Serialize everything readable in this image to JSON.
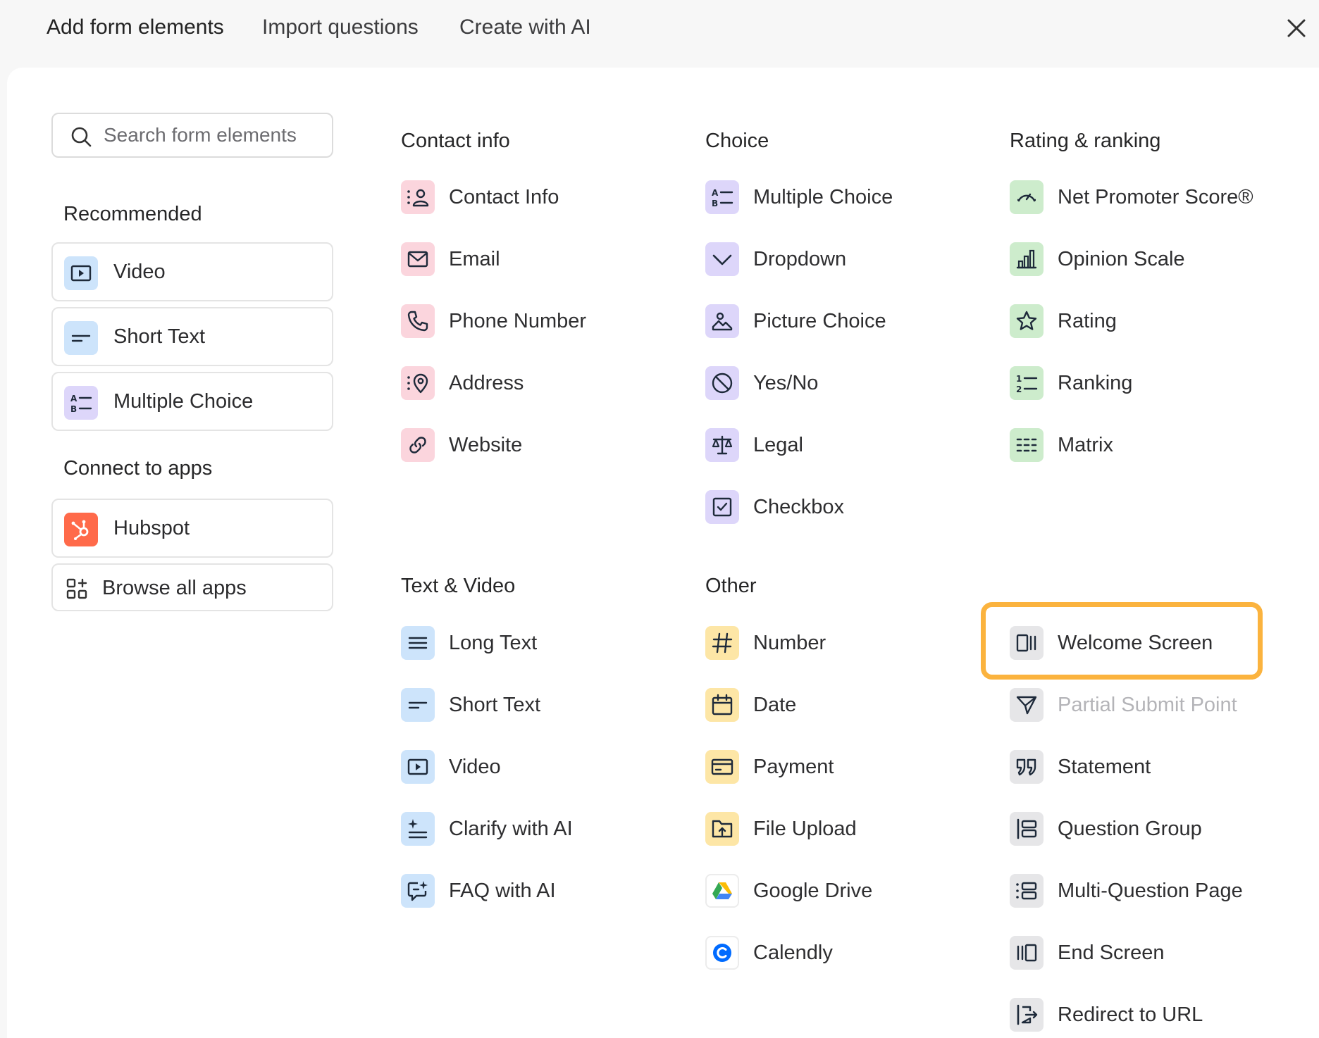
{
  "tabs": [
    {
      "label": "Add form elements"
    },
    {
      "label": "Import questions"
    },
    {
      "label": "Create with AI"
    }
  ],
  "search": {
    "placeholder": "Search form elements"
  },
  "sidebar": {
    "recommended_title": "Recommended",
    "recommended": [
      {
        "label": "Video",
        "icon": "video-icon"
      },
      {
        "label": "Short Text",
        "icon": "short-text-icon"
      },
      {
        "label": "Multiple Choice",
        "icon": "multiple-choice-icon"
      }
    ],
    "apps_title": "Connect to apps",
    "apps": [
      {
        "label": "Hubspot",
        "icon": "hubspot-icon"
      }
    ],
    "browse_label": "Browse all apps"
  },
  "sections": {
    "contact": {
      "title": "Contact info",
      "items": [
        "Contact Info",
        "Email",
        "Phone Number",
        "Address",
        "Website"
      ]
    },
    "choice": {
      "title": "Choice",
      "items": [
        "Multiple Choice",
        "Dropdown",
        "Picture Choice",
        "Yes/No",
        "Legal",
        "Checkbox"
      ]
    },
    "rating": {
      "title": "Rating & ranking",
      "items": [
        "Net Promoter Score®",
        "Opinion Scale",
        "Rating",
        "Ranking",
        "Matrix"
      ]
    },
    "text_video": {
      "title": "Text & Video",
      "items": [
        "Long Text",
        "Short Text",
        "Video",
        "Clarify with AI",
        "FAQ with AI"
      ]
    },
    "other": {
      "title": "Other",
      "items": [
        "Number",
        "Date",
        "Payment",
        "File Upload",
        "Google Drive",
        "Calendly"
      ]
    },
    "screens": {
      "items": [
        "Welcome Screen",
        "Partial Submit Point",
        "Statement",
        "Question Group",
        "Multi-Question Page",
        "End Screen",
        "Redirect to URL"
      ]
    }
  },
  "colors": {
    "contact": "#fbd5dd",
    "choice": "#ddd6fa",
    "rating": "#cdeccc",
    "text_video": "#cde4fb",
    "other": "#fde6a6",
    "screens": "#e6e6e8",
    "highlight": "#fbb33e",
    "hubspot": "#ff6a4a"
  }
}
